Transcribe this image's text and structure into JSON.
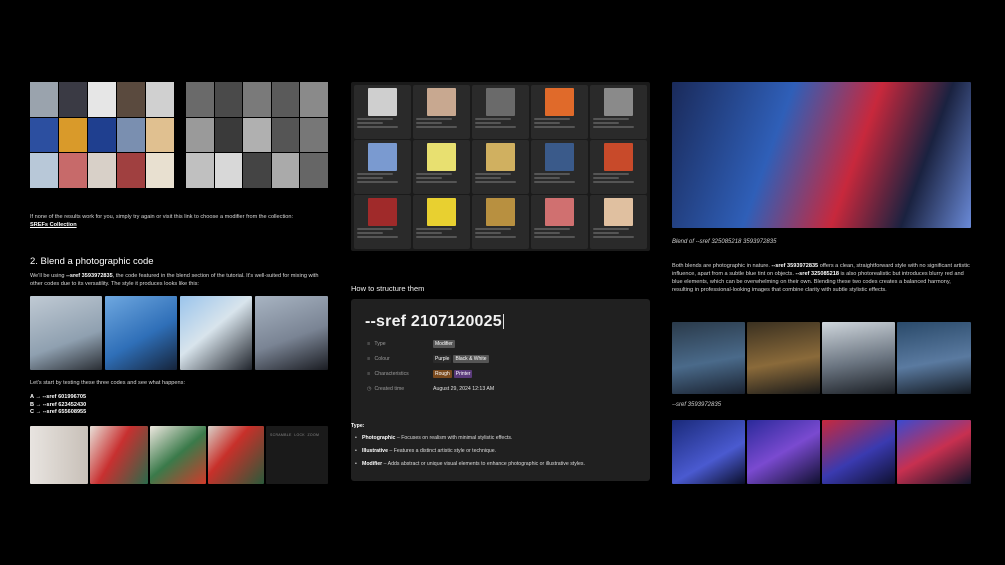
{
  "left": {
    "intro_text": "If none of the results work for you, simply try again or visit this link to choose a modifier from the collection:",
    "collection_link": "SREFs Collection",
    "section_heading": "2. Blend a photographic code",
    "blend_intro_pre": "We'll be using ",
    "blend_intro_code": "--sref 3593972835",
    "blend_intro_post": ", the code featured in the blend section of the tutorial. It's well-suited for mixing with other codes due to its versatility. The style it produces looks like this:",
    "test_intro": "Let's start by testing these three codes and see what happens:",
    "codes": [
      "A → --sref 601996705",
      "B → --sref 623452430",
      "C → --sref 655608955"
    ],
    "strip_labels": [
      "SCRAMBLE",
      "LOCK",
      "ZOOM"
    ]
  },
  "mid": {
    "structure_heading": "How to structure them",
    "db_title": "--sref 2107120025",
    "props": [
      {
        "icon": "≡",
        "label": "Type",
        "tags": [
          {
            "text": "Modifier",
            "color": "#555555"
          }
        ]
      },
      {
        "icon": "≡",
        "label": "Colour",
        "tags": [
          {
            "text": "Purple",
            "color": "#2b2b2b"
          },
          {
            "text": "Black & White",
            "color": "#555555"
          }
        ]
      },
      {
        "icon": "≡",
        "label": "Characteristics",
        "tags": [
          {
            "text": "Rough",
            "color": "#7a4a1e"
          },
          {
            "text": "Printer",
            "color": "#5a3a7a"
          }
        ]
      },
      {
        "icon": "◷",
        "label": "Created time",
        "value": "August 29, 2024 12:13 AM"
      }
    ],
    "type_label": "Type:",
    "types": [
      {
        "name": "Photographic",
        "desc": " – Focuses on realism with minimal stylistic effects."
      },
      {
        "name": "Illustrative",
        "desc": " – Features a distinct artistic style or technique."
      },
      {
        "name": "Modifier",
        "desc": " – Adds abstract or unique visual elements to enhance photographic or illustrative styles."
      }
    ]
  },
  "right": {
    "blend_caption": "Blend of --sref 325085218 3593972835",
    "desc_pre": "Both blends are photographic in nature. ",
    "desc_code1": "--sref 3593972835",
    "desc_mid": " offers a clean, straightforward style with no significant artistic influence, apart from a subtle blue tint on objects. ",
    "desc_code2": "--sref 325085218",
    "desc_post": " is also photorealistic but introduces blurry red and blue elements, which can be overwhelming on their own. Blending these two codes creates a balanced harmony, resulting in professional-looking images that combine clarity with subtle stylistic effects.",
    "mid_caption": "--sref 3593972835"
  },
  "colors": {
    "background": "#000000",
    "card": "#202020",
    "accent_blue": "#2f5fb8",
    "accent_red": "#c8283c"
  }
}
